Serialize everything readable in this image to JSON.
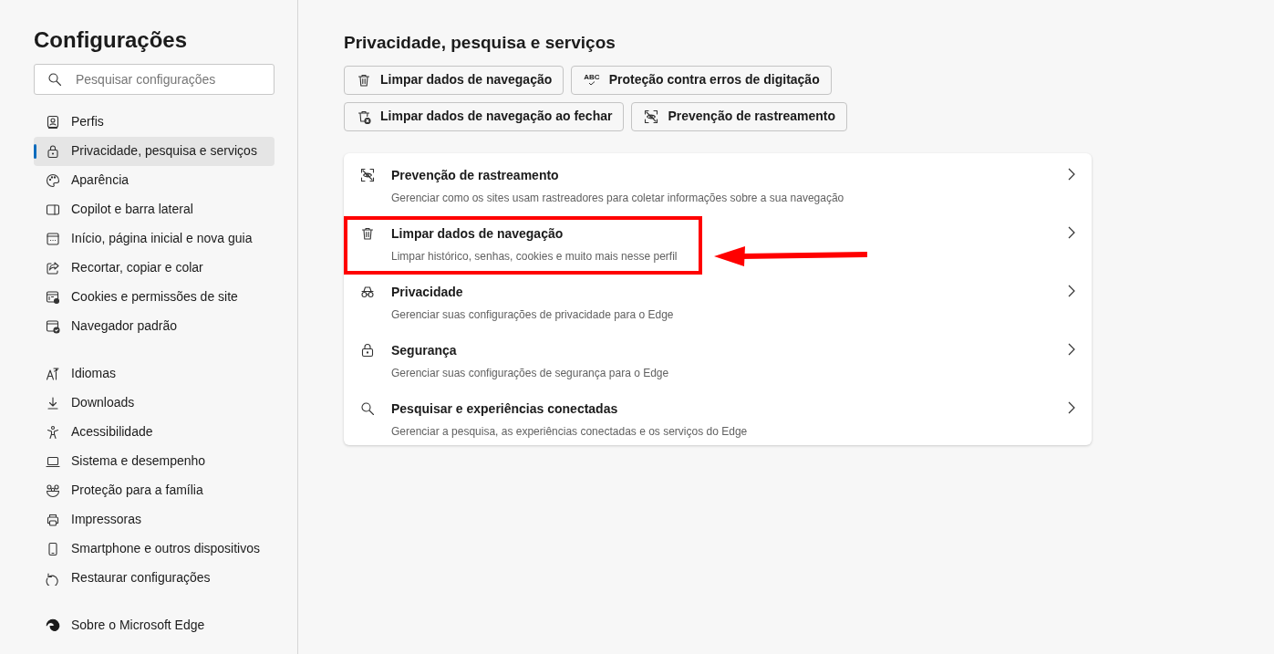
{
  "sidebar": {
    "title": "Configurações",
    "search": {
      "placeholder": "Pesquisar configurações"
    },
    "groups": [
      {
        "items": [
          {
            "label": "Perfis",
            "selected": false
          },
          {
            "label": "Privacidade, pesquisa e serviços",
            "selected": true
          },
          {
            "label": "Aparência",
            "selected": false
          },
          {
            "label": "Copilot e barra lateral",
            "selected": false
          },
          {
            "label": "Início, página inicial e nova guia",
            "selected": false
          },
          {
            "label": "Recortar, copiar e colar",
            "selected": false
          },
          {
            "label": "Cookies e permissões de site",
            "selected": false
          },
          {
            "label": "Navegador padrão",
            "selected": false
          }
        ]
      },
      {
        "items": [
          {
            "label": "Idiomas",
            "selected": false
          },
          {
            "label": "Downloads",
            "selected": false
          },
          {
            "label": "Acessibilidade",
            "selected": false
          },
          {
            "label": "Sistema e desempenho",
            "selected": false
          },
          {
            "label": "Proteção para a família",
            "selected": false
          },
          {
            "label": "Impressoras",
            "selected": false
          },
          {
            "label": "Smartphone e outros dispositivos",
            "selected": false
          },
          {
            "label": "Restaurar configurações",
            "selected": false
          }
        ]
      },
      {
        "items": [
          {
            "label": "Sobre o Microsoft Edge",
            "selected": false
          }
        ]
      }
    ]
  },
  "main": {
    "heading": "Privacidade, pesquisa e serviços",
    "quick_buttons": [
      [
        {
          "label": "Limpar dados de navegação"
        },
        {
          "label": "Proteção contra erros de digitação",
          "icon_text": "ABC"
        }
      ],
      [
        {
          "label": "Limpar dados de navegação ao fechar"
        },
        {
          "label": "Prevenção de rastreamento"
        }
      ]
    ],
    "rows": [
      {
        "title": "Prevenção de rastreamento",
        "description": "Gerenciar como os sites usam rastreadores para coletar informações sobre a sua navegação",
        "highlighted": false
      },
      {
        "title": "Limpar dados de navegação",
        "description": "Limpar histórico, senhas, cookies e muito mais nesse perfil",
        "highlighted": true
      },
      {
        "title": "Privacidade",
        "description": "Gerenciar suas configurações de privacidade para o Edge",
        "highlighted": false
      },
      {
        "title": "Segurança",
        "description": "Gerenciar suas configurações de segurança para o Edge",
        "highlighted": false
      },
      {
        "title": "Pesquisar e experiências conectadas",
        "description": "Gerenciar a pesquisa, as experiências conectadas e os serviços do Edge",
        "highlighted": false
      }
    ]
  }
}
